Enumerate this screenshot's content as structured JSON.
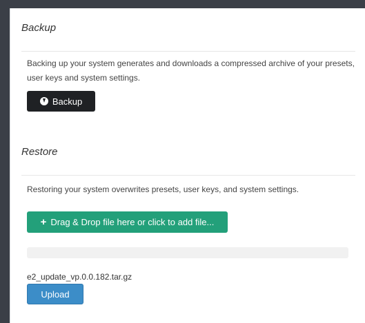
{
  "backup": {
    "title": "Backup",
    "description": "Backing up your system generates and downloads a compressed archive of your presets, user keys and system settings.",
    "button_label": "Backup",
    "button_icon": "circle-arrow-down-icon"
  },
  "restore": {
    "title": "Restore",
    "description": "Restoring your system overwrites presets, user keys, and system settings.",
    "dropzone_label": "Drag & Drop file here or click to add file...",
    "dropzone_icon": "plus-icon",
    "progress_percent": 0,
    "filename": "e2_update_vp.0.0.182.tar.gz",
    "upload_label": "Upload"
  },
  "colors": {
    "page_background": "#3b3f47",
    "panel_background": "#ffffff",
    "backup_button": "#1f2124",
    "dropzone_button": "#23a07a",
    "upload_button": "#3c8dc8"
  }
}
